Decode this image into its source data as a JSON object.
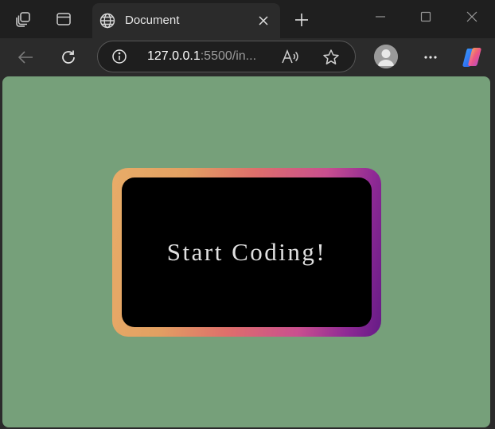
{
  "browser": {
    "tab": {
      "title": "Document",
      "favicon": "globe-icon"
    },
    "url": {
      "host": "127.0.0.1",
      "rest": ":5500/in..."
    },
    "icons": {
      "workspaces": "workspaces-icon",
      "tab_actions": "tab-actions-icon",
      "close_tab": "close-icon",
      "new_tab": "plus-icon",
      "minimize": "minimize-icon",
      "maximize": "maximize-icon",
      "close_window": "close-icon",
      "back": "arrow-left-icon",
      "refresh": "refresh-icon",
      "site_info": "info-icon",
      "read_aloud": "read-aloud-icon",
      "favorites": "star-icon",
      "profile": "profile-icon",
      "menu": "more-icon",
      "copilot": "copilot-icon"
    },
    "colors": {
      "titlebar": "#1f1f1f",
      "toolbar": "#2b2b2b",
      "omnibox": "#1e1e1e"
    }
  },
  "page": {
    "button_text": "Start Coding!",
    "colors": {
      "background": "#76a07a",
      "panel": "#000000",
      "text": "#e0e0e0",
      "gradient": [
        "#e8ac68",
        "#de6f6b",
        "#c94f8f",
        "#651b86"
      ]
    }
  }
}
